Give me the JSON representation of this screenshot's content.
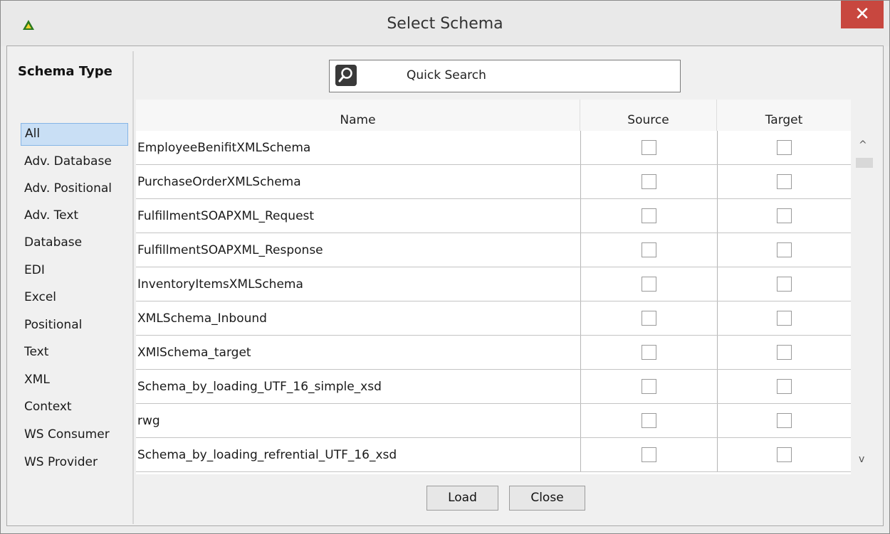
{
  "window": {
    "title": "Select Schema",
    "close_glyph": "✕",
    "app_icon": "triangle-logo-icon"
  },
  "sidebar": {
    "heading": "Schema Type",
    "selected": "All",
    "items": [
      {
        "label": "All"
      },
      {
        "label": "Adv. Database"
      },
      {
        "label": "Adv. Positional"
      },
      {
        "label": "Adv. Text"
      },
      {
        "label": "Database"
      },
      {
        "label": "EDI"
      },
      {
        "label": "Excel"
      },
      {
        "label": "Positional"
      },
      {
        "label": "Text"
      },
      {
        "label": "XML"
      },
      {
        "label": "Context"
      },
      {
        "label": "WS Consumer"
      },
      {
        "label": "WS Provider"
      }
    ]
  },
  "search": {
    "label": "Quick Search",
    "icon": "search-icon"
  },
  "table": {
    "columns": [
      "Name",
      "Source",
      "Target"
    ],
    "rows": [
      {
        "name": "EmployeeBenifitXMLSchema",
        "source": false,
        "target": false
      },
      {
        "name": "PurchaseOrderXMLSchema",
        "source": false,
        "target": false
      },
      {
        "name": "FulfillmentSOAPXML_Request",
        "source": false,
        "target": false
      },
      {
        "name": "FulfillmentSOAPXML_Response",
        "source": false,
        "target": false
      },
      {
        "name": "InventoryItemsXMLSchema",
        "source": false,
        "target": false
      },
      {
        "name": "XMLSchema_Inbound",
        "source": false,
        "target": false
      },
      {
        "name": "XMlSchema_target",
        "source": false,
        "target": false
      },
      {
        "name": "Schema_by_loading_UTF_16_simple_xsd",
        "source": false,
        "target": false
      },
      {
        "name": "rwg",
        "source": false,
        "target": false
      },
      {
        "name": "Schema_by_loading_refrential_UTF_16_xsd",
        "source": false,
        "target": false
      }
    ]
  },
  "scrollbar": {
    "up_glyph": "^",
    "down_glyph": "v"
  },
  "buttons": {
    "load": "Load",
    "close": "Close"
  },
  "colors": {
    "close_button": "#c8473f",
    "selection": "#c9dff5",
    "logo": "#2a7a1e"
  }
}
